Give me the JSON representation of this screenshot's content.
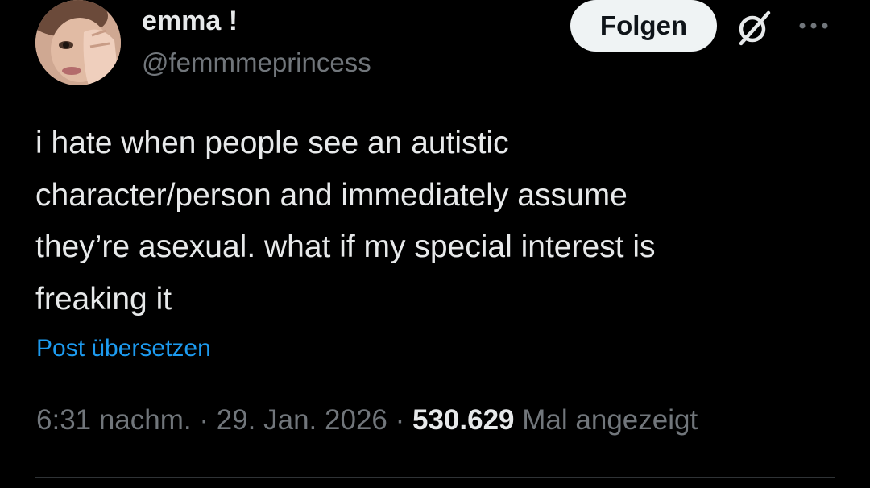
{
  "author": {
    "display_name": "emma !",
    "handle": "@femmmeprincess",
    "avatar_icon": "profile-photo"
  },
  "header_actions": {
    "follow_label": "Folgen",
    "grok_icon": "grok-icon",
    "more_icon": "more-options-icon"
  },
  "tweet": {
    "lines": [
      "i hate when people see an autistic",
      "character/person and immediately assume",
      "they’re asexual. what if my special interest is",
      "freaking it"
    ],
    "translate_label": "Post übersetzen"
  },
  "meta": {
    "time": "6:31 nachm.",
    "separator": "·",
    "date": "29. Jan. 2026",
    "views_count": "530.629",
    "views_label": "Mal angezeigt"
  },
  "colors": {
    "background": "#000000",
    "text_primary": "#e7e9ea",
    "text_secondary": "#71767b",
    "link": "#1d9bf0",
    "button_bg": "#eff3f4",
    "divider": "#2f3336"
  }
}
